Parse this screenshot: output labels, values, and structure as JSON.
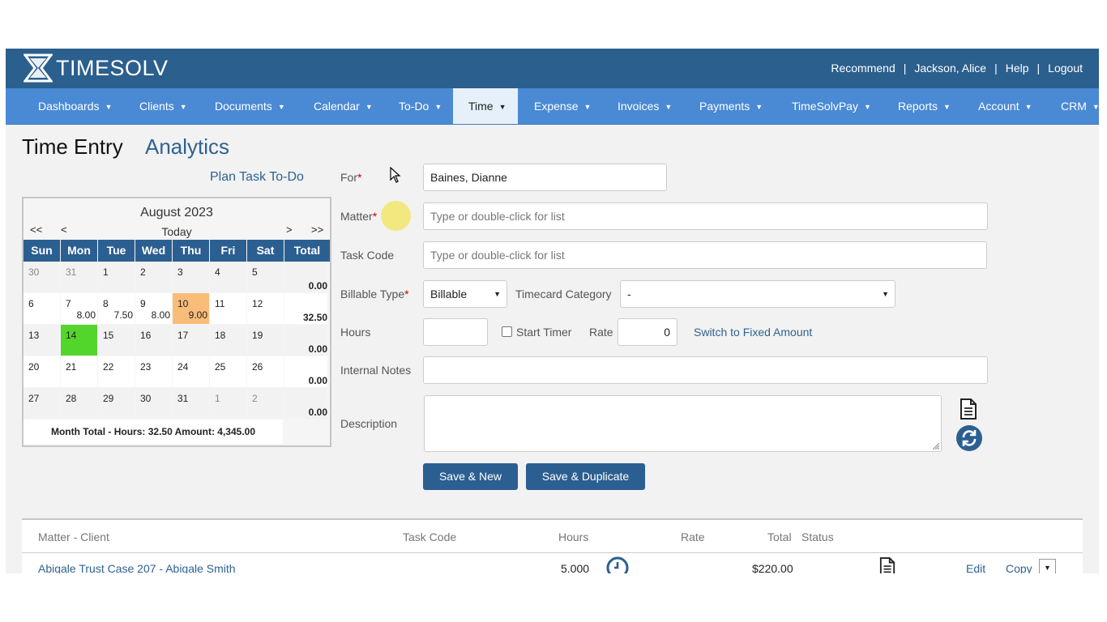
{
  "header": {
    "logo_text": "TIMESOLV",
    "links": [
      "Recommend",
      "Jackson, Alice",
      "Help",
      "Logout"
    ]
  },
  "nav": {
    "items": [
      "Dashboards",
      "Clients",
      "Documents",
      "Calendar",
      "To-Do",
      "Time",
      "Expense",
      "Invoices",
      "Payments",
      "TimeSolvPay",
      "Reports",
      "Account",
      "CRM"
    ],
    "active": "Time"
  },
  "page": {
    "title": "Time Entry",
    "analytics_tab": "Analytics",
    "plan_link": "Plan Task To-Do"
  },
  "calendar": {
    "month": "August 2023",
    "nav_first": "<<",
    "nav_prev": "<",
    "today": "Today",
    "nav_next": ">",
    "nav_last": ">>",
    "headers": [
      "Sun",
      "Mon",
      "Tue",
      "Wed",
      "Thu",
      "Fri",
      "Sat",
      "Total"
    ],
    "weeks": [
      {
        "days": [
          {
            "d": "30",
            "h": ""
          },
          {
            "d": "31",
            "h": ""
          },
          {
            "d": "1",
            "h": ""
          },
          {
            "d": "2",
            "h": ""
          },
          {
            "d": "3",
            "h": ""
          },
          {
            "d": "4",
            "h": ""
          },
          {
            "d": "5",
            "h": ""
          }
        ],
        "total": "0.00"
      },
      {
        "days": [
          {
            "d": "6",
            "h": ""
          },
          {
            "d": "7",
            "h": "8.00"
          },
          {
            "d": "8",
            "h": "7.50"
          },
          {
            "d": "9",
            "h": "8.00"
          },
          {
            "d": "10",
            "h": "9.00"
          },
          {
            "d": "11",
            "h": ""
          },
          {
            "d": "12",
            "h": ""
          }
        ],
        "total": "32.50"
      },
      {
        "days": [
          {
            "d": "13",
            "h": ""
          },
          {
            "d": "14",
            "h": ""
          },
          {
            "d": "15",
            "h": ""
          },
          {
            "d": "16",
            "h": ""
          },
          {
            "d": "17",
            "h": ""
          },
          {
            "d": "18",
            "h": ""
          },
          {
            "d": "19",
            "h": ""
          }
        ],
        "total": "0.00"
      },
      {
        "days": [
          {
            "d": "20",
            "h": ""
          },
          {
            "d": "21",
            "h": ""
          },
          {
            "d": "22",
            "h": ""
          },
          {
            "d": "23",
            "h": ""
          },
          {
            "d": "24",
            "h": ""
          },
          {
            "d": "25",
            "h": ""
          },
          {
            "d": "26",
            "h": ""
          }
        ],
        "total": "0.00"
      },
      {
        "days": [
          {
            "d": "27",
            "h": ""
          },
          {
            "d": "28",
            "h": ""
          },
          {
            "d": "29",
            "h": ""
          },
          {
            "d": "30",
            "h": ""
          },
          {
            "d": "31",
            "h": ""
          },
          {
            "d": "1",
            "h": ""
          },
          {
            "d": "2",
            "h": ""
          }
        ],
        "total": "0.00"
      }
    ],
    "month_total": "Month Total - Hours: 32.50   Amount: 4,345.00",
    "colors": {
      "selected": "#52d62b",
      "highlight": "#f9bd79",
      "header": "#2c5f91"
    }
  },
  "form": {
    "for_label": "For",
    "for_value": "Baines, Dianne",
    "matter_label": "Matter",
    "matter_placeholder": "Type or double-click for list",
    "task_label": "Task Code",
    "task_placeholder": "Type or double-click for list",
    "billable_label": "Billable Type",
    "billable_value": "Billable",
    "category_label": "Timecard Category",
    "category_value": "-",
    "hours_label": "Hours",
    "hours_value": "",
    "start_timer": "Start Timer",
    "rate_label": "Rate",
    "rate_value": "0",
    "switch_link": "Switch to Fixed Amount",
    "notes_label": "Internal Notes",
    "description_label": "Description",
    "save_new": "Save & New",
    "save_dup": "Save & Duplicate",
    "required_mark": "*"
  },
  "table": {
    "headers": {
      "matter": "Matter - Client",
      "task": "Task Code",
      "hours": "Hours",
      "rate": "Rate",
      "total": "Total",
      "status": "Status"
    },
    "rows": [
      {
        "matter": "Abigale Trust Case 207 - Abigale Smith",
        "hours": "5.000",
        "total": "$220.00",
        "edit": "Edit",
        "copy": "Copy"
      }
    ]
  }
}
